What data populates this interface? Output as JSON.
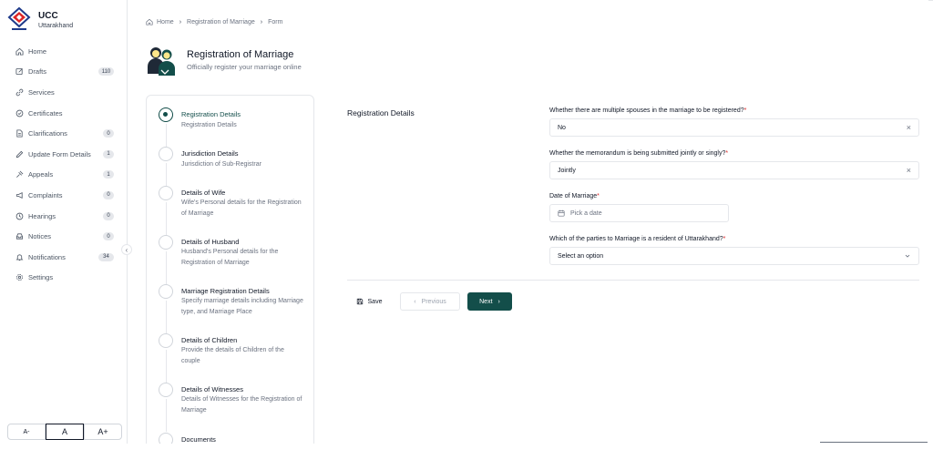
{
  "brand": {
    "title": "UCC",
    "subtitle": "Uttarakhand",
    "logo_icon": "uttarakhand-emblem-icon"
  },
  "sidebar": {
    "items": [
      {
        "label": "Home",
        "icon": "home-icon",
        "badge": null
      },
      {
        "label": "Drafts",
        "icon": "edit-icon",
        "badge": "110"
      },
      {
        "label": "Services",
        "icon": "link-icon",
        "badge": null
      },
      {
        "label": "Certificates",
        "icon": "shield-check-icon",
        "badge": null
      },
      {
        "label": "Clarifications",
        "icon": "file-icon",
        "badge": "0"
      },
      {
        "label": "Update Form Details",
        "icon": "pencil-icon",
        "badge": "1"
      },
      {
        "label": "Appeals",
        "icon": "gavel-icon",
        "badge": "1"
      },
      {
        "label": "Complaints",
        "icon": "megaphone-icon",
        "badge": "0"
      },
      {
        "label": "Hearings",
        "icon": "clock-icon",
        "badge": "0"
      },
      {
        "label": "Notices",
        "icon": "inbox-icon",
        "badge": "0"
      },
      {
        "label": "Notifications",
        "icon": "bell-icon",
        "badge": "34"
      },
      {
        "label": "Settings",
        "icon": "gear-icon",
        "badge": null
      }
    ],
    "font_size": {
      "decrease": "A-",
      "normal": "A",
      "increase": "A+"
    }
  },
  "breadcrumb": {
    "home": "Home",
    "section": "Registration of Marriage",
    "current": "Form"
  },
  "page": {
    "title": "Registration of Marriage",
    "subtitle": "Officially register your marriage online"
  },
  "steps": [
    {
      "title": "Registration Details",
      "desc": "Registration Details",
      "active": true
    },
    {
      "title": "Jurisdiction Details",
      "desc": "Jurisdiction of Sub-Registrar",
      "active": false
    },
    {
      "title": "Details of Wife",
      "desc": "Wife's Personal details for the Registration of Marriage",
      "active": false
    },
    {
      "title": "Details of Husband",
      "desc": "Husband's Personal details for the Registration of Marriage",
      "active": false
    },
    {
      "title": "Marriage Registration Details",
      "desc": "Specify marriage details including Marriage type, and Marriage Place",
      "active": false
    },
    {
      "title": "Details of Children",
      "desc": "Provide the details of Children of the couple",
      "active": false
    },
    {
      "title": "Details of Witnesses",
      "desc": "Details of Witnesses for the Registration of Marriage",
      "active": false
    },
    {
      "title": "Documents",
      "desc": "",
      "active": false
    }
  ],
  "form": {
    "section_label": "Registration Details",
    "multiple_spouses": {
      "label": "Whether there are multiple spouses in the marriage to be registered?",
      "value": "No"
    },
    "memorandum": {
      "label": "Whether the memorandum is being submitted jointly or singly?",
      "value": "Jointly"
    },
    "date_of_marriage": {
      "label": "Date of Marriage",
      "placeholder": "Pick a date"
    },
    "resident": {
      "label": "Which of the parties to Marriage is a resident of Uttarakhand?",
      "value": "Select an option"
    },
    "required_mark": "*"
  },
  "actions": {
    "save": "Save",
    "previous": "Previous",
    "next": "Next"
  },
  "colors": {
    "primary": "#134e4a",
    "required": "#dc2626"
  }
}
